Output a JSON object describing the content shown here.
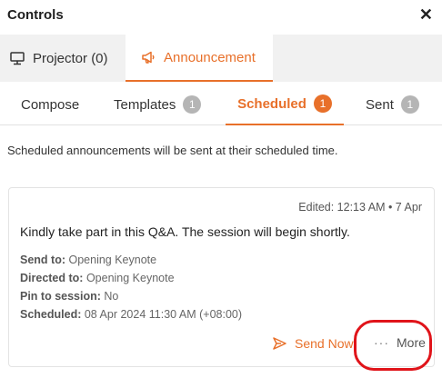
{
  "header": {
    "title": "Controls",
    "close_glyph": "✕"
  },
  "top_tabs": [
    {
      "label": "Projector (0)",
      "icon": "projector-icon"
    },
    {
      "label": "Announcement",
      "icon": "megaphone-icon",
      "active": true
    }
  ],
  "sub_tabs": [
    {
      "label": "Compose"
    },
    {
      "label": "Templates",
      "badge": "1"
    },
    {
      "label": "Scheduled",
      "badge": "1",
      "active": true
    },
    {
      "label": "Sent",
      "badge": "1"
    }
  ],
  "notice": "Scheduled announcements will be sent at their scheduled time.",
  "card": {
    "edited": "Edited: 12:13 AM • 7 Apr",
    "message": "Kindly take part in this Q&A. The session will begin shortly.",
    "meta": [
      {
        "label": "Send to:",
        "value": "Opening Keynote"
      },
      {
        "label": "Directed to:",
        "value": "Opening Keynote"
      },
      {
        "label": "Pin to session:",
        "value": "No"
      },
      {
        "label": "Scheduled:",
        "value": "08 Apr 2024 11:30 AM (+08:00)"
      }
    ],
    "actions": {
      "send_now": "Send Now",
      "more_dots": "···",
      "more": "More"
    }
  },
  "colors": {
    "accent": "#e8702a",
    "highlight": "#e0141a",
    "badge_gray": "#b5b5b5"
  }
}
